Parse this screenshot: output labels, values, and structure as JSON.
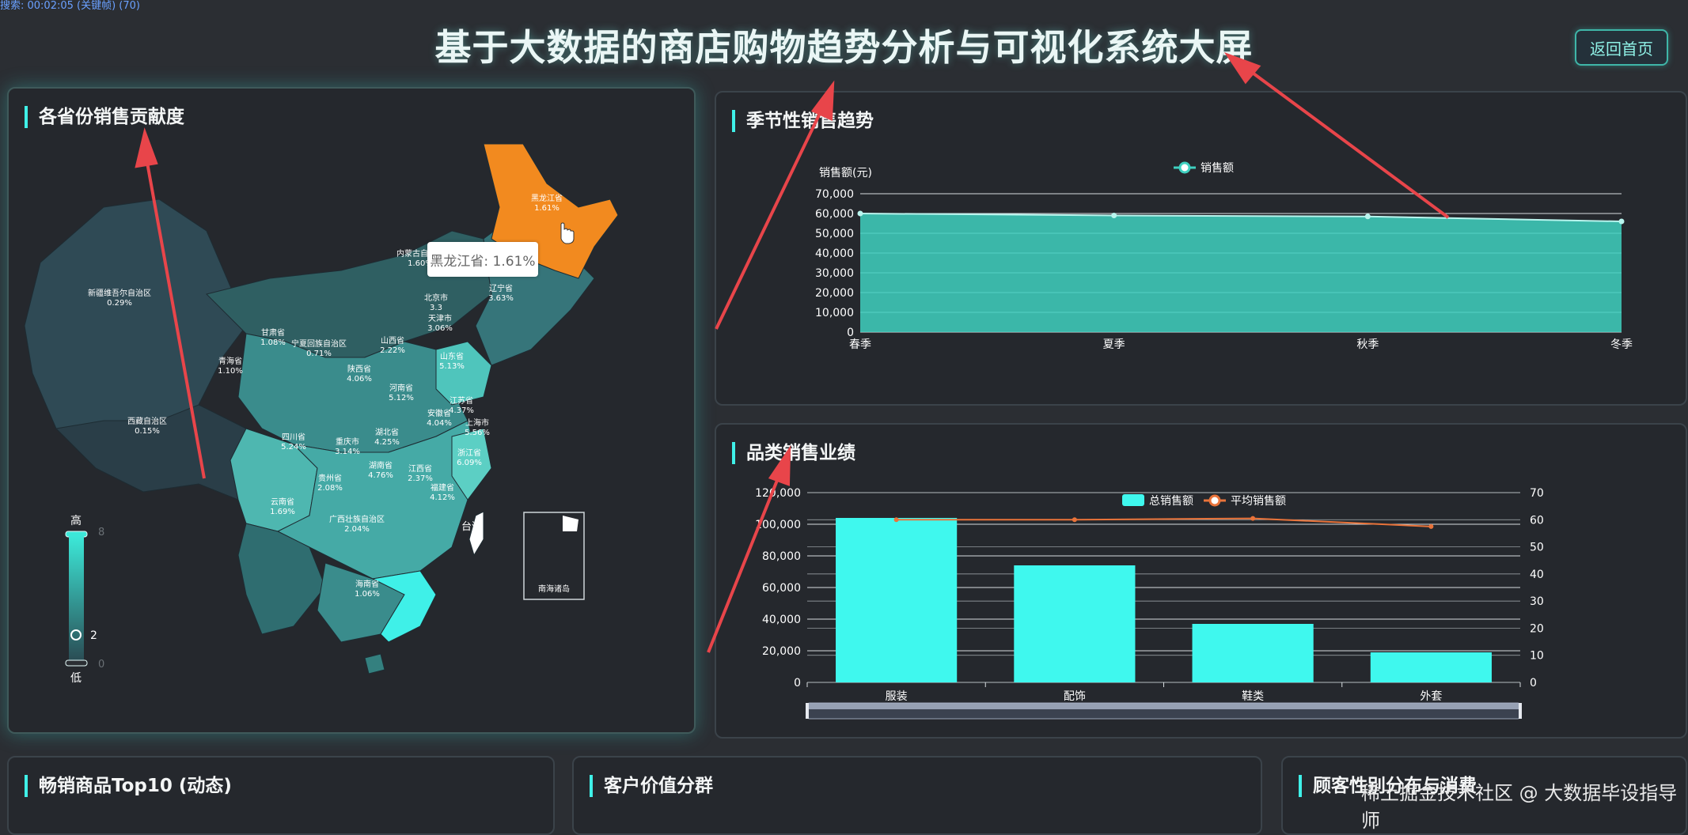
{
  "header": {
    "status_text": "搜索: 00:02:05 (关键帧) (70)",
    "title": "基于大数据的商店购物趋势分析与可视化系统大屏",
    "home_button": "返回首页"
  },
  "map_panel": {
    "title": "各省份销售贡献度",
    "tooltip": "黑龙江省: 1.61%",
    "legend": {
      "high": "高",
      "low": "低",
      "value": "2",
      "max_tick": "8",
      "min_tick": "0"
    },
    "south_sea_label": "南海诸岛",
    "taiwan_label": "台湾",
    "highlight_color": "#f28a1f",
    "provinces": [
      {
        "name": "黑龙江省",
        "value": "1.61%"
      },
      {
        "name": "内蒙古自治区",
        "value": "1.60%"
      },
      {
        "name": "新疆维吾尔自治区",
        "value": "0.29%"
      },
      {
        "name": "辽宁省",
        "value": "3.63%"
      },
      {
        "name": "北京市",
        "value": "3.3"
      },
      {
        "name": "天津市",
        "value": "3.06%"
      },
      {
        "name": "甘肃省",
        "value": "1.08%"
      },
      {
        "name": "宁夏回族自治区",
        "value": "0.71%"
      },
      {
        "name": "山西省",
        "value": "2.22%"
      },
      {
        "name": "山东省",
        "value": "5.13%"
      },
      {
        "name": "青海省",
        "value": "1.10%"
      },
      {
        "name": "陕西省",
        "value": "4.06%"
      },
      {
        "name": "河南省",
        "value": "5.12%"
      },
      {
        "name": "江苏省",
        "value": "4.37%"
      },
      {
        "name": "西藏自治区",
        "value": "0.15%"
      },
      {
        "name": "安徽省",
        "value": "4.04%"
      },
      {
        "name": "上海市",
        "value": "5.56%"
      },
      {
        "name": "四川省",
        "value": "5.24%"
      },
      {
        "name": "湖北省",
        "value": "4.25%"
      },
      {
        "name": "重庆市",
        "value": "3.14%"
      },
      {
        "name": "浙江省",
        "value": "6.09%"
      },
      {
        "name": "湖南省",
        "value": "4.76%"
      },
      {
        "name": "江西省",
        "value": "2.37%"
      },
      {
        "name": "贵州省",
        "value": "2.08%"
      },
      {
        "name": "福建省",
        "value": "4.12%"
      },
      {
        "name": "云南省",
        "value": "1.69%"
      },
      {
        "name": "广西壮族自治区",
        "value": "2.04%"
      },
      {
        "name": "海南省",
        "value": "1.06%"
      }
    ]
  },
  "seasonal_panel": {
    "title": "季节性销售趋势",
    "chart_data": {
      "type": "area",
      "categories": [
        "春季",
        "夏季",
        "秋季",
        "冬季"
      ],
      "series": [
        {
          "name": "销售额",
          "values": [
            60000,
            59000,
            58500,
            56000
          ]
        }
      ],
      "ylabel": "销售额(元)",
      "ylim": [
        0,
        70000
      ],
      "yticks": [
        "0",
        "10,000",
        "20,000",
        "30,000",
        "40,000",
        "50,000",
        "60,000",
        "70,000"
      ],
      "color": "#3fd0c0",
      "legend": "top-center"
    }
  },
  "category_panel": {
    "title": "品类销售业绩",
    "chart_data": {
      "type": "bar",
      "categories": [
        "服装",
        "配饰",
        "鞋类",
        "外套"
      ],
      "series": [
        {
          "name": "总销售额",
          "type": "bar",
          "values": [
            104000,
            74000,
            37000,
            19000
          ],
          "axis": "left"
        },
        {
          "name": "平均销售额",
          "type": "line",
          "values": [
            60,
            60,
            60.5,
            57.5
          ],
          "axis": "right"
        }
      ],
      "ylim": [
        0,
        120000
      ],
      "yticks": [
        "0",
        "20,000",
        "40,000",
        "60,000",
        "80,000",
        "100,000",
        "120,000"
      ],
      "y2lim": [
        0,
        70
      ],
      "y2ticks": [
        "0",
        "10",
        "20",
        "30",
        "40",
        "50",
        "60",
        "70"
      ],
      "bar_color": "#3ff8ee",
      "line_color": "#e9733a",
      "legend": "top-center"
    }
  },
  "bottom_panels": {
    "top10_title": "畅销商品Top10 (动态)",
    "customer_title": "客户价值分群",
    "gender_title": "顾客性别分布与消费"
  },
  "watermark": "稀土掘金技术社区 @ 大数据毕设指导师"
}
